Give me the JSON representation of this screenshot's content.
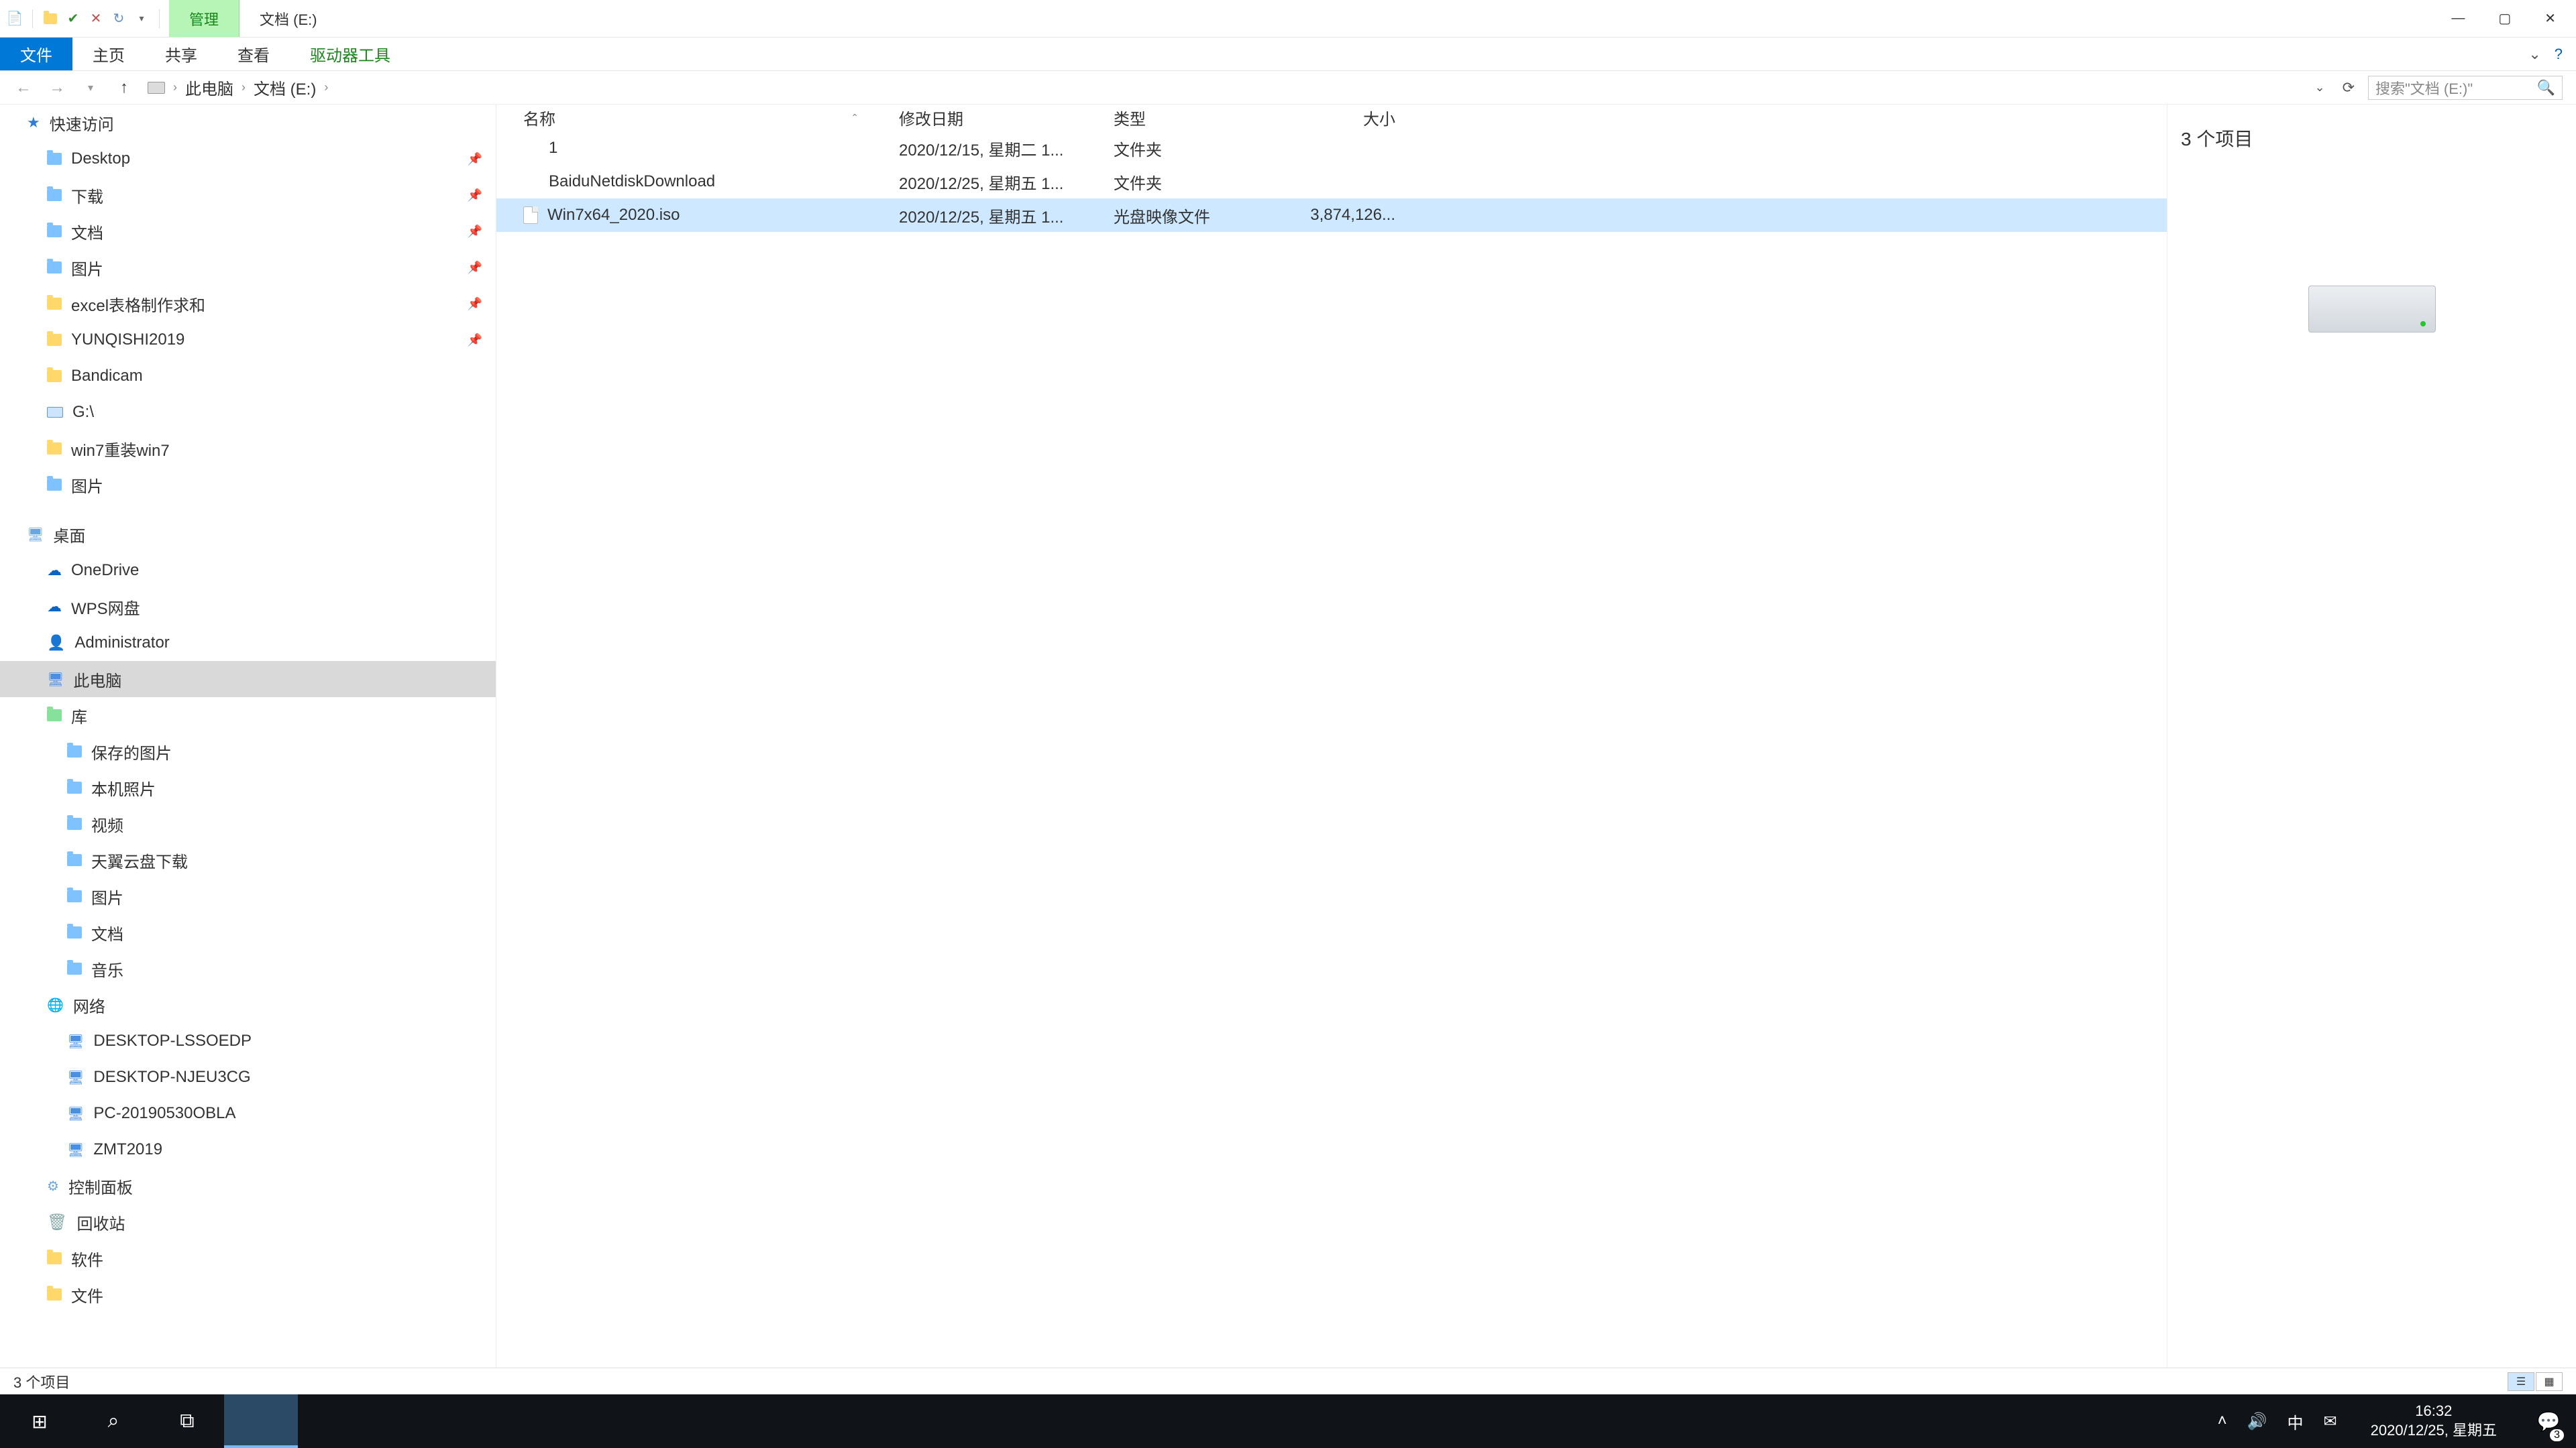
{
  "titlebar": {
    "contextual_tab": "管理",
    "window_title": "文档 (E:)"
  },
  "ribbon": {
    "file": "文件",
    "home": "主页",
    "share": "共享",
    "view": "查看",
    "drive_tools": "驱动器工具"
  },
  "breadcrumb": {
    "root": "此电脑",
    "current": "文档 (E:)"
  },
  "search": {
    "placeholder": "搜索\"文档 (E:)\""
  },
  "tree": {
    "quick_access": "快速访问",
    "desktop": "Desktop",
    "downloads": "下载",
    "documents": "文档",
    "pictures": "图片",
    "excel_folder": "excel表格制作求和",
    "yunqishi": "YUNQISHI2019",
    "bandicam": "Bandicam",
    "g_drive": "G:\\",
    "win7_reinstall": "win7重装win7",
    "pictures2": "图片",
    "desktop_group": "桌面",
    "onedrive": "OneDrive",
    "wps_cloud": "WPS网盘",
    "administrator": "Administrator",
    "this_pc": "此电脑",
    "libraries": "库",
    "saved_pictures": "保存的图片",
    "camera_roll": "本机照片",
    "videos": "视频",
    "tianyi": "天翼云盘下载",
    "pictures3": "图片",
    "documents2": "文档",
    "music": "音乐",
    "network": "网络",
    "pc1": "DESKTOP-LSSOEDP",
    "pc2": "DESKTOP-NJEU3CG",
    "pc3": "PC-20190530OBLA",
    "pc4": "ZMT2019",
    "control_panel": "控制面板",
    "recycle_bin": "回收站",
    "software": "软件",
    "files": "文件"
  },
  "columns": {
    "name": "名称",
    "date": "修改日期",
    "type": "类型",
    "size": "大小"
  },
  "files": [
    {
      "name": "1",
      "date": "2020/12/15, 星期二 1...",
      "type": "文件夹",
      "size": "",
      "kind": "folder",
      "selected": false
    },
    {
      "name": "BaiduNetdiskDownload",
      "date": "2020/12/25, 星期五 1...",
      "type": "文件夹",
      "size": "",
      "kind": "folder",
      "selected": false
    },
    {
      "name": "Win7x64_2020.iso",
      "date": "2020/12/25, 星期五 1...",
      "type": "光盘映像文件",
      "size": "3,874,126...",
      "kind": "iso",
      "selected": true
    }
  ],
  "preview": {
    "item_count": "3 个项目"
  },
  "statusbar": {
    "text": "3 个项目"
  },
  "taskbar": {
    "ime": "中",
    "time": "16:32",
    "date": "2020/12/25, 星期五",
    "notif_count": "3"
  }
}
